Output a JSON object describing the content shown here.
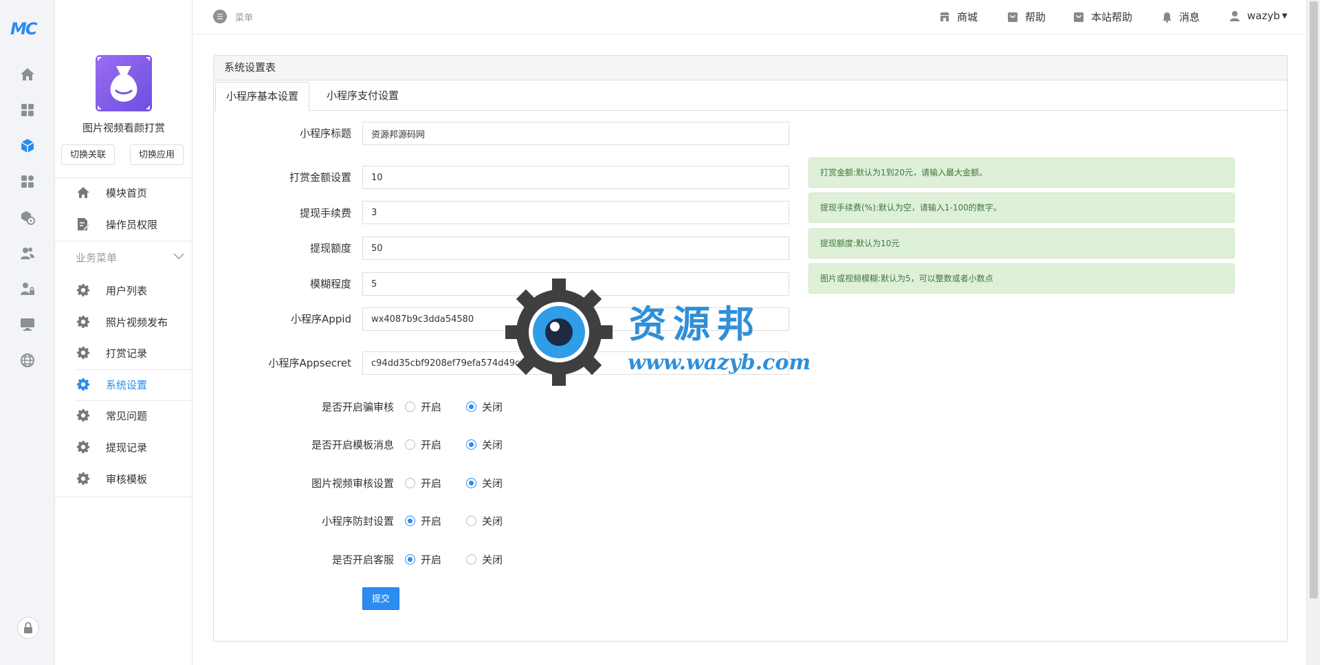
{
  "brand": {
    "logo_text": "MC"
  },
  "rail": {
    "items": [
      {
        "icon": "home-icon"
      },
      {
        "icon": "apps-icon"
      },
      {
        "icon": "cube-icon"
      },
      {
        "icon": "modules-icon"
      },
      {
        "icon": "plugin-icon"
      },
      {
        "icon": "users-icon"
      },
      {
        "icon": "user-lock-icon"
      },
      {
        "icon": "monitor-icon"
      },
      {
        "icon": "globe-icon"
      }
    ]
  },
  "sidebar": {
    "app_name": "图片视频看颜打赏",
    "switch_link_label": "切换关联",
    "switch_app_label": "切换应用",
    "top_items": [
      {
        "label": "模块首页",
        "icon": "home-icon"
      },
      {
        "label": "操作员权限",
        "icon": "edit-icon"
      }
    ],
    "group_label": "业务菜单",
    "items": [
      {
        "label": "用户列表",
        "icon": "gear-icon"
      },
      {
        "label": "照片视频发布",
        "icon": "gear-icon"
      },
      {
        "label": "打赏记录",
        "icon": "gear-icon"
      },
      {
        "label": "系统设置",
        "icon": "gear-icon",
        "active": true
      },
      {
        "label": "常见问题",
        "icon": "gear-icon"
      },
      {
        "label": "提现记录",
        "icon": "gear-icon"
      },
      {
        "label": "审核模板",
        "icon": "gear-icon"
      }
    ]
  },
  "header": {
    "menu_label": "菜单",
    "links": [
      {
        "label": "商城",
        "icon": "store-icon"
      },
      {
        "label": "帮助",
        "icon": "bag-icon"
      },
      {
        "label": "本站帮助",
        "icon": "bag-icon"
      },
      {
        "label": "消息",
        "icon": "bell-icon"
      },
      {
        "label": "wazyb",
        "icon": "user-icon"
      }
    ]
  },
  "panel": {
    "title": "系统设置表",
    "tabs": [
      {
        "label": "小程序基本设置",
        "active": true
      },
      {
        "label": "小程序支付设置"
      }
    ]
  },
  "form": {
    "fields": [
      {
        "label": "小程序标题",
        "value": "资源邦源码网"
      },
      {
        "label": "打赏金额设置",
        "value": "10"
      },
      {
        "label": "提现手续费",
        "value": "3"
      },
      {
        "label": "提现额度",
        "value": "50"
      },
      {
        "label": "模糊程度",
        "value": "5"
      },
      {
        "label": "小程序Appid",
        "value": "wx4087b9c3dda54580"
      },
      {
        "label": "小程序Appsecret",
        "value": "c94dd35cbf9208ef79efa574d49ca57"
      }
    ],
    "tips": [
      "打赏金额:默认为1到20元，请输入最大金额。",
      "提现手续费(%):默认为空，请输入1-100的数字。",
      "提现额度:默认为10元",
      "图片或视频模糊:默认为5，可以整数或者小数点"
    ],
    "radios": [
      {
        "label": "是否开启骗审核",
        "on_label": "开启",
        "off_label": "关闭",
        "selected": "off"
      },
      {
        "label": "是否开启模板消息",
        "on_label": "开启",
        "off_label": "关闭",
        "selected": "off"
      },
      {
        "label": "图片视频审核设置",
        "on_label": "开启",
        "off_label": "关闭",
        "selected": "off"
      },
      {
        "label": "小程序防封设置",
        "on_label": "开启",
        "off_label": "关闭",
        "selected": "on"
      },
      {
        "label": "是否开启客服",
        "on_label": "开启",
        "off_label": "关闭",
        "selected": "on"
      }
    ],
    "submit_label": "提交"
  },
  "watermark": {
    "title": "资源邦",
    "url": "www.wazyb.com"
  },
  "colors": {
    "accent": "#2b8cf0",
    "tip_bg": "#dff0d8",
    "tip_text": "#3c763d"
  }
}
